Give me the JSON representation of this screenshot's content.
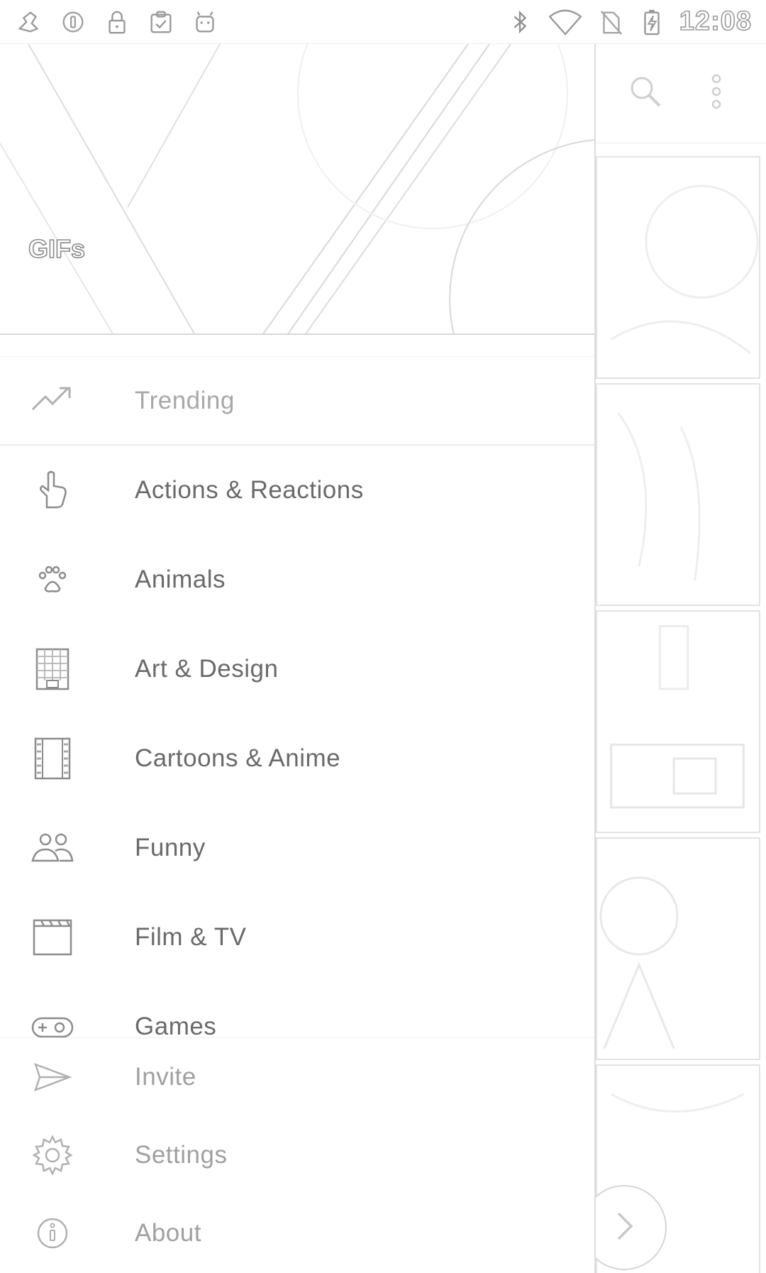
{
  "status_bar": {
    "left_icons": [
      "fav-icon",
      "dnd-circle-icon",
      "lock-icon",
      "clipboard-check-icon",
      "android-icon"
    ],
    "right_icons": [
      "bluetooth-icon",
      "wifi-icon",
      "no-sim-icon",
      "battery-charging-icon"
    ],
    "time": "12:08"
  },
  "drawer": {
    "header_title": "GIFs",
    "categories": [
      {
        "label": "Trending",
        "icon": "trending-up-icon"
      },
      {
        "label": "Actions & Reactions",
        "icon": "pointing-hand-icon"
      },
      {
        "label": "Animals",
        "icon": "paw-icon"
      },
      {
        "label": "Art & Design",
        "icon": "grid-icon"
      },
      {
        "label": "Cartoons & Anime",
        "icon": "film-strip-icon"
      },
      {
        "label": "Funny",
        "icon": "people-icon"
      },
      {
        "label": "Film & TV",
        "icon": "clapperboard-icon"
      },
      {
        "label": "Games",
        "icon": "gamepad-icon"
      }
    ],
    "footer": [
      {
        "label": "Invite",
        "icon": "send-icon"
      },
      {
        "label": "Settings",
        "icon": "gear-icon"
      },
      {
        "label": "About",
        "icon": "info-icon"
      }
    ]
  },
  "background_app": {
    "toolbar_icons": [
      "search-icon",
      "more-vert-icon"
    ],
    "fab_icon": "chevron-right-icon"
  }
}
